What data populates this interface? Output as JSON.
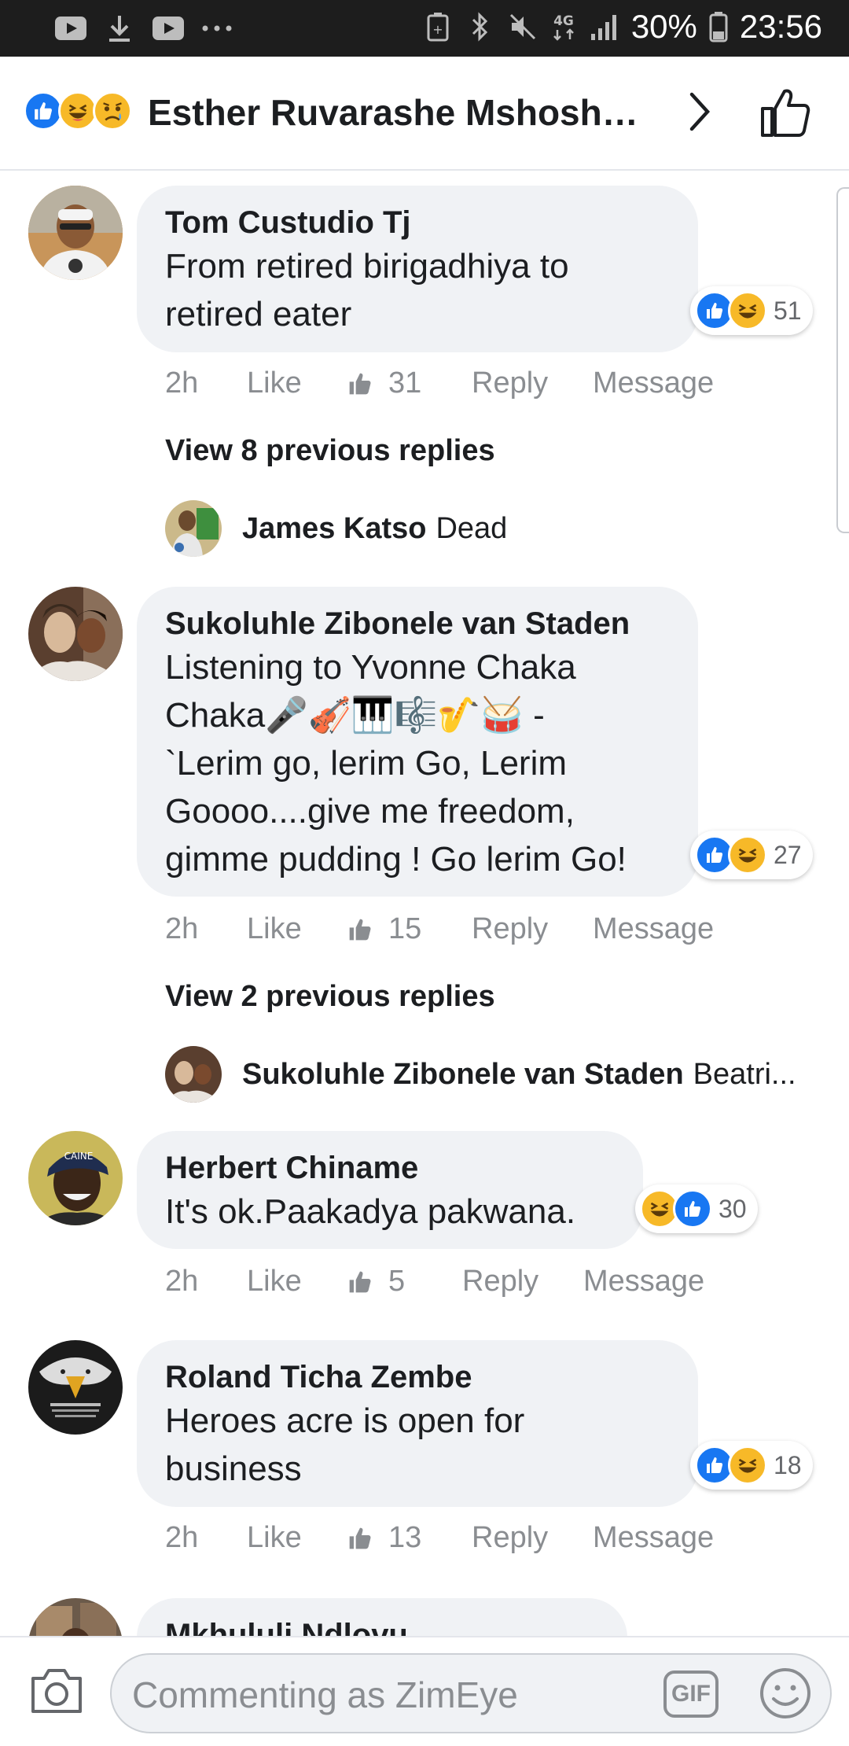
{
  "status_bar": {
    "battery": "30%",
    "time": "23:56",
    "network": "4G"
  },
  "header": {
    "title": "Esther Ruvarashe Mshosho ...",
    "reactions": [
      "like-icon",
      "haha-icon",
      "sad-icon"
    ]
  },
  "comments": [
    {
      "author": "Tom Custudio Tj",
      "text": "From retired birigadhiya to retired eater",
      "line1": "From retired birigadhiya to",
      "line2": "retired eater",
      "reaction_count": "51",
      "time": "2h",
      "like": "Like",
      "likes": "31",
      "reply": "Reply",
      "message": "Message",
      "view_replies": "View 8 previous replies",
      "reply_preview": {
        "author": "James Katso",
        "text": "Dead"
      }
    },
    {
      "author": "Sukoluhle Zibonele van Staden",
      "line1": "Listening to Yvonne Chaka",
      "line2": "Chaka🎤🎻🎹🎼🎷🥁 -",
      "line3": "`Lerim go, lerim Go, Lerim",
      "line4": "Goooo....give me freedom,",
      "line5": "gimme pudding ! Go lerim Go!",
      "reaction_count": "27",
      "time": "2h",
      "like": "Like",
      "likes": "15",
      "reply": "Reply",
      "message": "Message",
      "view_replies": "View 2 previous replies",
      "reply_preview": {
        "author": "Sukoluhle Zibonele van Staden",
        "text": "Beatri..."
      }
    },
    {
      "author": "Herbert Chiname",
      "line1": "It's ok.Paakadya pakwana.",
      "reaction_count": "30",
      "time": "2h",
      "like": "Like",
      "likes": "5",
      "reply": "Reply",
      "message": "Message"
    },
    {
      "author": "Roland Ticha Zembe",
      "line1": "Heroes acre is open for",
      "line2": "business",
      "reaction_count": "18",
      "time": "2h",
      "like": "Like",
      "likes": "13",
      "reply": "Reply",
      "message": "Message"
    },
    {
      "author": "Mkhululi Ndlovu"
    }
  ],
  "composer": {
    "placeholder": "Commenting as ZimEye",
    "gif_label": "GIF"
  },
  "colors": {
    "like_blue": "#1877f2",
    "haha_yellow": "#f7b928",
    "bubble_bg": "#f0f2f5",
    "meta_gray": "#8a8d91"
  }
}
